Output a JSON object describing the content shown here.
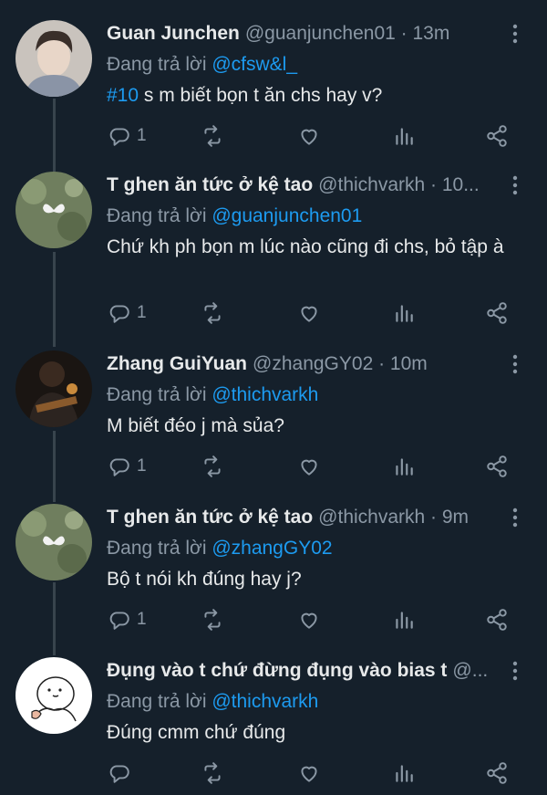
{
  "tweets": [
    {
      "name": "Guan Junchen",
      "handle": "@guanjunchen01 · 13m",
      "reply_prefix": "Đang trả lời",
      "reply_to": "@cfsw&l_",
      "hashtag": "#10",
      "text": " s m biết bọn t ăn chs hay v?",
      "reply_count": "1",
      "avatar": "person-photo"
    },
    {
      "name": "T ghen ăn tức ở kệ tao",
      "handle": "@thichvarkh · 10...",
      "reply_prefix": "Đang trả lời",
      "reply_to": "@guanjunchen01",
      "text": "Chứ kh ph bọn m lúc nào cũng đi chs, bỏ tập à",
      "reply_count": "1",
      "avatar": "butterfly-photo"
    },
    {
      "name": "Zhang GuiYuan",
      "handle": "@zhangGY02 · 10m",
      "reply_prefix": "Đang trả lời",
      "reply_to": "@thichvarkh",
      "text": "M biết đéo j mà sủa?",
      "reply_count": "1",
      "avatar": "guitarist-photo"
    },
    {
      "name": "T ghen ăn tức ở kệ tao",
      "handle": "@thichvarkh · 9m",
      "reply_prefix": "Đang trả lời",
      "reply_to": "@zhangGY02",
      "text": "Bộ t nói kh đúng hay j?",
      "reply_count": "1",
      "avatar": "butterfly-photo"
    },
    {
      "name": "Đụng vào t chứ đừng đụng vào bias t",
      "handle": "@...",
      "reply_prefix": "Đang trả lời",
      "reply_to": "@thichvarkh",
      "text": "Đúng cmm chứ đúng",
      "reply_count": "",
      "avatar": "cartoon-drawing"
    }
  ],
  "icons": [
    "reply-icon",
    "retweet-icon",
    "like-icon",
    "views-icon",
    "share-icon",
    "more-icon"
  ],
  "colors": {
    "background": "#15202b",
    "accent": "#1d9bf0",
    "muted": "#8b98a5",
    "text": "#e7e9ea",
    "thread": "#38444d"
  }
}
